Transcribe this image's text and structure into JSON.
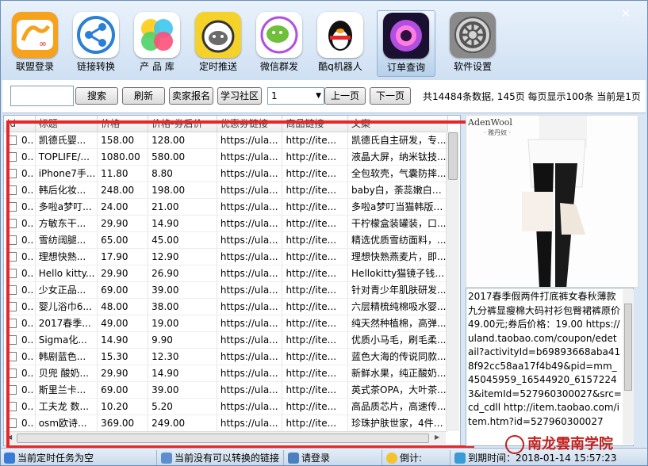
{
  "toolbar": {
    "items": [
      {
        "label": "联盟登录",
        "icon": "kangaroo-icon",
        "color": "#f6a21c"
      },
      {
        "label": "链接转换",
        "icon": "share-icon",
        "color": "#2a7fd6"
      },
      {
        "label": "产 品 库",
        "icon": "color-balls-icon",
        "color": "#ff4f7a"
      },
      {
        "label": "定时推送",
        "icon": "alarm-clock-icon",
        "color": "#f4d22a"
      },
      {
        "label": "微信群发",
        "icon": "wechat-icon",
        "color": "#6fbf3b"
      },
      {
        "label": "酷q机器人",
        "icon": "qq-penguin-icon",
        "color": "#e8262a"
      },
      {
        "label": "订单查询",
        "icon": "camera-icon",
        "color": "#b24fe0"
      },
      {
        "label": "软件设置",
        "icon": "gear-icon",
        "color": "#6b6b6b"
      }
    ]
  },
  "controls": {
    "search_value": "",
    "search_label": "搜索",
    "refresh_label": "刷新",
    "seller_signup_label": "卖家报名",
    "community_label": "学习社区",
    "page_select": "1",
    "prev_label": "上一页",
    "next_label": "下一页",
    "page_info": "共14484条数据, 145页  每页显示100条  当前是1页"
  },
  "table": {
    "columns": [
      "id",
      "标题",
      "价格",
      "价格-券后价",
      "优惠券链接",
      "商品链接",
      "文案"
    ],
    "rows": [
      [
        "0..",
        "凯德氏婴...",
        "158.00",
        "128.00",
        "https://ula...",
        "http://ite...",
        "凯德氏自主研发，专..."
      ],
      [
        "0..",
        "TOPLIFE/...",
        "1080.00",
        "580.00",
        "https://ula...",
        "http://ite...",
        "液晶大屏，纳米钛技..."
      ],
      [
        "0..",
        "iPhone7手...",
        "11.80",
        "8.80",
        "https://ula...",
        "http://ite...",
        "全包软壳，气囊防摔..."
      ],
      [
        "0..",
        "韩后化妆...",
        "248.00",
        "198.00",
        "https://ula...",
        "http://ite...",
        "baby白，荼蕊嫩白，..."
      ],
      [
        "0..",
        "多啦a梦叮...",
        "24.00",
        "21.00",
        "https://ula...",
        "http://ite...",
        "多啦a梦叮当猫韩版设..."
      ],
      [
        "0..",
        "方敏东干...",
        "29.90",
        "14.90",
        "https://ula...",
        "http://ite...",
        "干柠檬盒装罐装，口..."
      ],
      [
        "0..",
        "雪纺阔腿...",
        "65.00",
        "45.00",
        "https://ula...",
        "http://ite...",
        "精选优质雪纺面料，..."
      ],
      [
        "0..",
        "理想快熟...",
        "17.90",
        "12.90",
        "https://ula...",
        "http://ite...",
        "理想快熟燕麦片，即..."
      ],
      [
        "0..",
        "Hello kitty...",
        "29.90",
        "26.90",
        "https://ula...",
        "http://ite...",
        "Hellokitty猫镜子钱包..."
      ],
      [
        "0..",
        "少女正品...",
        "69.00",
        "39.00",
        "https://ula...",
        "http://ite...",
        "针对青少年肌肤研发..."
      ],
      [
        "0..",
        "婴儿浴巾6...",
        "48.00",
        "38.00",
        "https://ula...",
        "http://ite...",
        "六层精梳纯棉吸水婴..."
      ],
      [
        "0..",
        "2017春季...",
        "49.00",
        "19.00",
        "https://ula...",
        "http://ite...",
        "纯天然种植棉，高弹..."
      ],
      [
        "0..",
        "Sigma化...",
        "14.90",
        "9.90",
        "https://ula...",
        "http://ite...",
        "优质小马毛，刷毛柔..."
      ],
      [
        "0..",
        "韩剧蓝色...",
        "15.30",
        "12.30",
        "https://ula...",
        "http://ite...",
        "蓝色大海的传说同款..."
      ],
      [
        "0..",
        "贝兜 酸奶...",
        "29.90",
        "14.90",
        "https://ula...",
        "http://ite...",
        "新鲜水果，纯正酸奶..."
      ],
      [
        "0..",
        "斯里兰卡...",
        "69.00",
        "39.00",
        "https://ula...",
        "http://ite...",
        "英式茶OPA，大叶茶..."
      ],
      [
        "0..",
        "工夫龙 数...",
        "10.20",
        "5.20",
        "https://ula...",
        "http://ite...",
        "高品质芯片，高速传..."
      ],
      [
        "0..",
        "osm欧诗...",
        "369.00",
        "249.00",
        "https://ula...",
        "http://ite...",
        "珍珠护肤世家，4件套..."
      ]
    ]
  },
  "product": {
    "brand": "AdenWool",
    "brand_sub": "· 雅丹奴 ·",
    "description": "2017春季假两件打底裤女春秋薄款九分裤显瘦棉大码衬衫包臀裙裤原价 49.00元;券后价格：19.00 https://uland.taobao.com/coupon/edetail?activityId=b69893668aba418f92cc58aa17f4b49&pid=mm_45045959_16544920_61572243&itemId=527960300027&src=cd_cdll http://item.taobao.com/item.htm?id=527960300027"
  },
  "status": {
    "task": "当前定时任务为空",
    "links": "当前没有可以转换的链接",
    "login": "请登录",
    "countdown_label": "倒计:",
    "expire": "到期时间：2018-01-14 15:57:23"
  },
  "watermark": "南龙雲南学院",
  "colors": {
    "accent_red": "#e8262a",
    "window_bg": "#d9e6f4"
  }
}
